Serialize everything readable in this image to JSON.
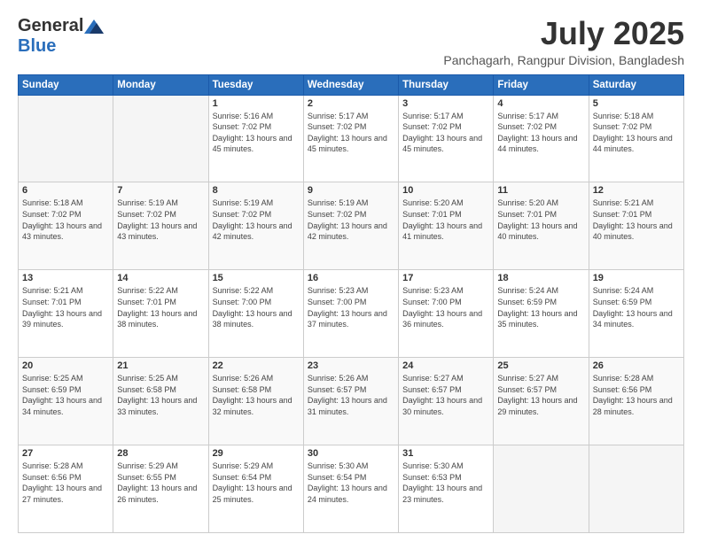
{
  "header": {
    "logo_general": "General",
    "logo_blue": "Blue",
    "title": "July 2025",
    "location": "Panchagarh, Rangpur Division, Bangladesh"
  },
  "days_of_week": [
    "Sunday",
    "Monday",
    "Tuesday",
    "Wednesday",
    "Thursday",
    "Friday",
    "Saturday"
  ],
  "weeks": [
    [
      {
        "day": "",
        "info": ""
      },
      {
        "day": "",
        "info": ""
      },
      {
        "day": "1",
        "info": "Sunrise: 5:16 AM\nSunset: 7:02 PM\nDaylight: 13 hours and 45 minutes."
      },
      {
        "day": "2",
        "info": "Sunrise: 5:17 AM\nSunset: 7:02 PM\nDaylight: 13 hours and 45 minutes."
      },
      {
        "day": "3",
        "info": "Sunrise: 5:17 AM\nSunset: 7:02 PM\nDaylight: 13 hours and 45 minutes."
      },
      {
        "day": "4",
        "info": "Sunrise: 5:17 AM\nSunset: 7:02 PM\nDaylight: 13 hours and 44 minutes."
      },
      {
        "day": "5",
        "info": "Sunrise: 5:18 AM\nSunset: 7:02 PM\nDaylight: 13 hours and 44 minutes."
      }
    ],
    [
      {
        "day": "6",
        "info": "Sunrise: 5:18 AM\nSunset: 7:02 PM\nDaylight: 13 hours and 43 minutes."
      },
      {
        "day": "7",
        "info": "Sunrise: 5:19 AM\nSunset: 7:02 PM\nDaylight: 13 hours and 43 minutes."
      },
      {
        "day": "8",
        "info": "Sunrise: 5:19 AM\nSunset: 7:02 PM\nDaylight: 13 hours and 42 minutes."
      },
      {
        "day": "9",
        "info": "Sunrise: 5:19 AM\nSunset: 7:02 PM\nDaylight: 13 hours and 42 minutes."
      },
      {
        "day": "10",
        "info": "Sunrise: 5:20 AM\nSunset: 7:01 PM\nDaylight: 13 hours and 41 minutes."
      },
      {
        "day": "11",
        "info": "Sunrise: 5:20 AM\nSunset: 7:01 PM\nDaylight: 13 hours and 40 minutes."
      },
      {
        "day": "12",
        "info": "Sunrise: 5:21 AM\nSunset: 7:01 PM\nDaylight: 13 hours and 40 minutes."
      }
    ],
    [
      {
        "day": "13",
        "info": "Sunrise: 5:21 AM\nSunset: 7:01 PM\nDaylight: 13 hours and 39 minutes."
      },
      {
        "day": "14",
        "info": "Sunrise: 5:22 AM\nSunset: 7:01 PM\nDaylight: 13 hours and 38 minutes."
      },
      {
        "day": "15",
        "info": "Sunrise: 5:22 AM\nSunset: 7:00 PM\nDaylight: 13 hours and 38 minutes."
      },
      {
        "day": "16",
        "info": "Sunrise: 5:23 AM\nSunset: 7:00 PM\nDaylight: 13 hours and 37 minutes."
      },
      {
        "day": "17",
        "info": "Sunrise: 5:23 AM\nSunset: 7:00 PM\nDaylight: 13 hours and 36 minutes."
      },
      {
        "day": "18",
        "info": "Sunrise: 5:24 AM\nSunset: 6:59 PM\nDaylight: 13 hours and 35 minutes."
      },
      {
        "day": "19",
        "info": "Sunrise: 5:24 AM\nSunset: 6:59 PM\nDaylight: 13 hours and 34 minutes."
      }
    ],
    [
      {
        "day": "20",
        "info": "Sunrise: 5:25 AM\nSunset: 6:59 PM\nDaylight: 13 hours and 34 minutes."
      },
      {
        "day": "21",
        "info": "Sunrise: 5:25 AM\nSunset: 6:58 PM\nDaylight: 13 hours and 33 minutes."
      },
      {
        "day": "22",
        "info": "Sunrise: 5:26 AM\nSunset: 6:58 PM\nDaylight: 13 hours and 32 minutes."
      },
      {
        "day": "23",
        "info": "Sunrise: 5:26 AM\nSunset: 6:57 PM\nDaylight: 13 hours and 31 minutes."
      },
      {
        "day": "24",
        "info": "Sunrise: 5:27 AM\nSunset: 6:57 PM\nDaylight: 13 hours and 30 minutes."
      },
      {
        "day": "25",
        "info": "Sunrise: 5:27 AM\nSunset: 6:57 PM\nDaylight: 13 hours and 29 minutes."
      },
      {
        "day": "26",
        "info": "Sunrise: 5:28 AM\nSunset: 6:56 PM\nDaylight: 13 hours and 28 minutes."
      }
    ],
    [
      {
        "day": "27",
        "info": "Sunrise: 5:28 AM\nSunset: 6:56 PM\nDaylight: 13 hours and 27 minutes."
      },
      {
        "day": "28",
        "info": "Sunrise: 5:29 AM\nSunset: 6:55 PM\nDaylight: 13 hours and 26 minutes."
      },
      {
        "day": "29",
        "info": "Sunrise: 5:29 AM\nSunset: 6:54 PM\nDaylight: 13 hours and 25 minutes."
      },
      {
        "day": "30",
        "info": "Sunrise: 5:30 AM\nSunset: 6:54 PM\nDaylight: 13 hours and 24 minutes."
      },
      {
        "day": "31",
        "info": "Sunrise: 5:30 AM\nSunset: 6:53 PM\nDaylight: 13 hours and 23 minutes."
      },
      {
        "day": "",
        "info": ""
      },
      {
        "day": "",
        "info": ""
      }
    ]
  ]
}
